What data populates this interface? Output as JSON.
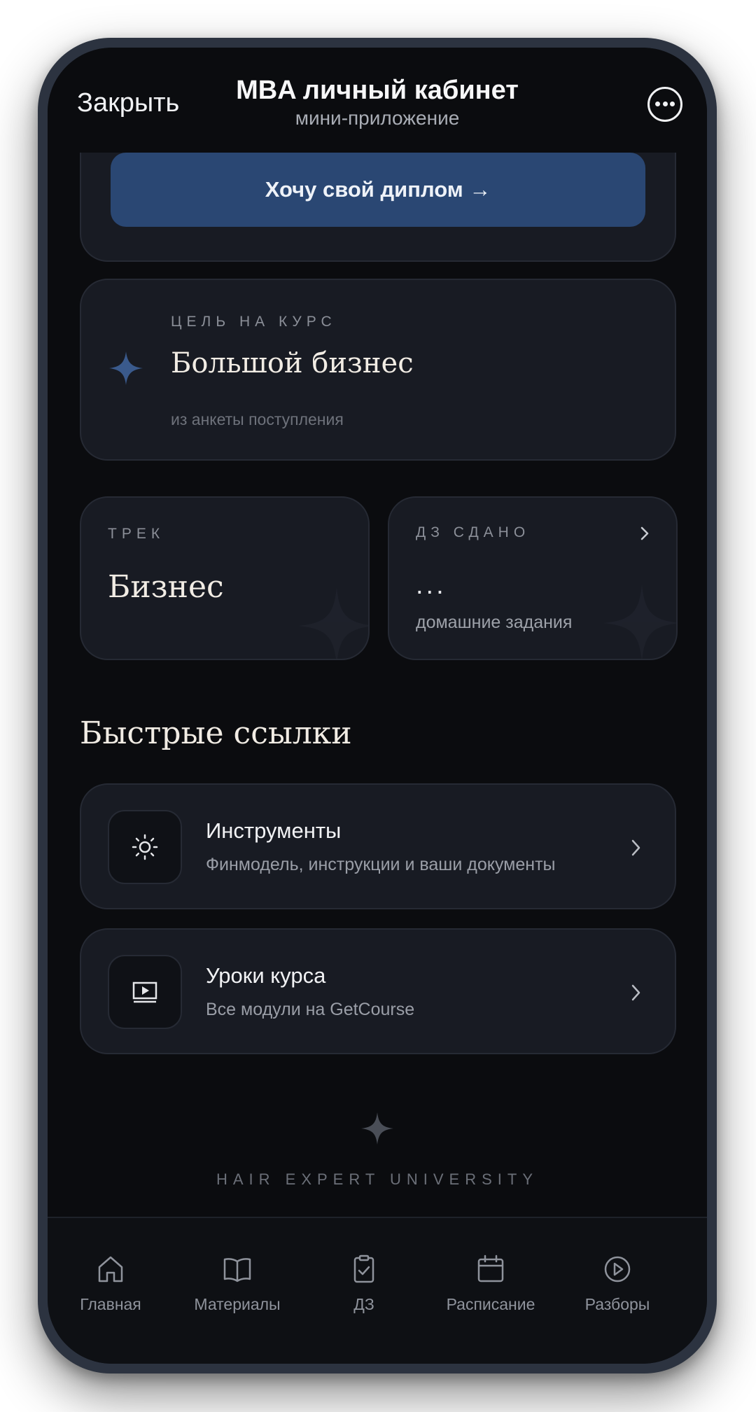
{
  "header": {
    "close_label": "Закрыть",
    "title": "MBA личный кабинет",
    "subtitle": "мини-приложение",
    "more_icon": "more-horizontal-icon"
  },
  "diploma": {
    "button_label": "Хочу свой диплом →"
  },
  "goal": {
    "label": "ЦЕЛЬ НА КУРС",
    "value": "Большой бизнес",
    "note": "из анкеты поступления",
    "icon": "sparkle-icon"
  },
  "track": {
    "label": "ТРЕК",
    "value": "Бизнес"
  },
  "homework": {
    "label": "ДЗ СДАНО",
    "value": "...",
    "note": "домашние задания"
  },
  "quick_links": {
    "title": "Быстрые ссылки",
    "items": [
      {
        "title": "Инструменты",
        "description": "Финмодель, инструкции и ваши документы",
        "icon": "sun-icon"
      },
      {
        "title": "Уроки курса",
        "description": "Все модули на GetCourse",
        "icon": "video-play-icon"
      }
    ]
  },
  "footer": {
    "brand": "HAIR EXPERT UNIVERSITY"
  },
  "tabbar": {
    "items": [
      {
        "label": "Главная",
        "icon": "home-icon"
      },
      {
        "label": "Материалы",
        "icon": "book-icon"
      },
      {
        "label": "ДЗ",
        "icon": "clipboard-check-icon"
      },
      {
        "label": "Расписание",
        "icon": "calendar-icon"
      },
      {
        "label": "Разборы",
        "icon": "play-circle-icon"
      }
    ]
  },
  "colors": {
    "background": "#0b0c0f",
    "card": "#181b23",
    "accent_button": "#2a4773",
    "accent_star": "#3a5a8c"
  }
}
